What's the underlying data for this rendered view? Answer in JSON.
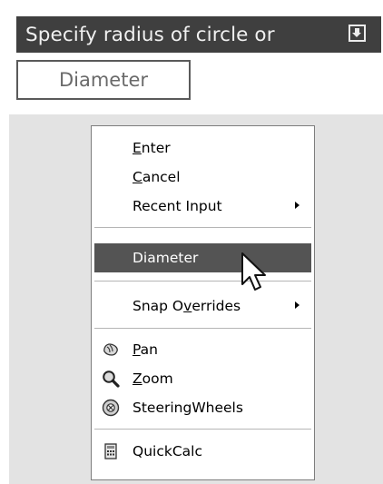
{
  "prompt": {
    "text": "Specify radius of circle or",
    "arrow_icon": "down-arrow-icon"
  },
  "option_box": {
    "label": "Diameter"
  },
  "context_menu": {
    "enter": {
      "pre": "",
      "key": "E",
      "post": "nter"
    },
    "cancel": {
      "pre": "",
      "key": "C",
      "post": "ancel"
    },
    "recent_input": {
      "label": "Recent Input",
      "has_submenu": true
    },
    "diameter": {
      "label": "Diameter",
      "highlighted": true
    },
    "snap_overrides": {
      "pre": "Snap O",
      "key": "v",
      "post": "errides",
      "has_submenu": true
    },
    "pan": {
      "pre": "",
      "key": "P",
      "post": "an",
      "icon": "pan-hand-icon"
    },
    "zoom": {
      "pre": "",
      "key": "Z",
      "post": "oom",
      "icon": "zoom-magnifier-icon"
    },
    "steering_wheels": {
      "label": "SteeringWheels",
      "icon": "steering-wheel-icon"
    },
    "quickcalc": {
      "label": "QuickCalc",
      "icon": "calculator-icon"
    }
  },
  "colors": {
    "prompt_bg": "#3f3f3f",
    "highlight_bg": "#545454",
    "menu_area_bg": "#e3e3e3"
  }
}
